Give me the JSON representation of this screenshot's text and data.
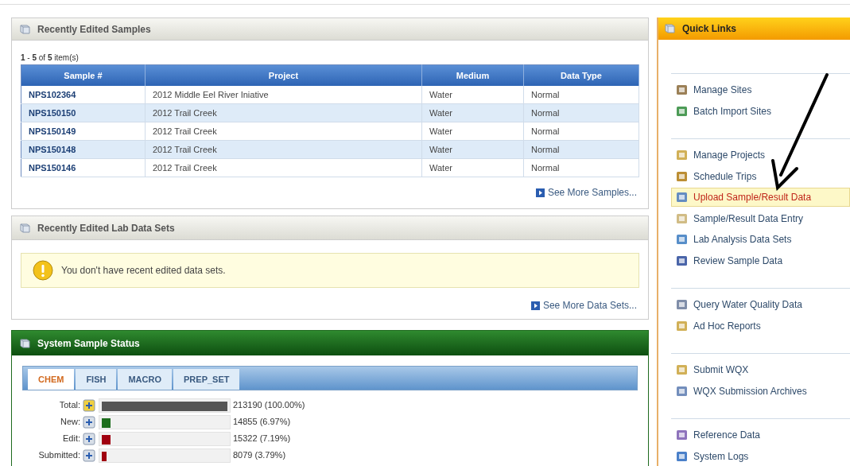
{
  "recent_samples": {
    "title": "Recently Edited Samples",
    "count_parts": [
      "1",
      "-",
      "5",
      "of",
      "5",
      "item(s)"
    ],
    "table": {
      "columns": [
        "Sample #",
        "Project",
        "Medium",
        "Data Type"
      ],
      "rows": [
        [
          "NPS102364",
          "2012 Middle Eel River Iniative",
          "Water",
          "Normal"
        ],
        [
          "NPS150150",
          "2012 Trail Creek",
          "Water",
          "Normal"
        ],
        [
          "NPS150149",
          "2012 Trail Creek",
          "Water",
          "Normal"
        ],
        [
          "NPS150148",
          "2012 Trail Creek",
          "Water",
          "Normal"
        ],
        [
          "NPS150146",
          "2012 Trail Creek",
          "Water",
          "Normal"
        ]
      ]
    },
    "more_link": "See More Samples..."
  },
  "lab_data_sets": {
    "title": "Recently Edited Lab Data Sets",
    "notice": "You don't have recent edited data sets.",
    "more_link": "See More Data Sets..."
  },
  "sample_status": {
    "title": "System Sample Status",
    "tabs": [
      {
        "label": "CHEM",
        "selected": true
      },
      {
        "label": "FISH",
        "selected": false
      },
      {
        "label": "MACRO",
        "selected": false
      },
      {
        "label": "PREP_SET",
        "selected": false
      }
    ],
    "stats": [
      {
        "label": "Total:",
        "level": 1,
        "color": "#555555",
        "reading": "213190 (100.00%)"
      },
      {
        "label": "New:",
        "level": 0.0697,
        "color": "#1e6e1e",
        "reading": "14855 (6.97%)"
      },
      {
        "label": "Edit:",
        "level": 0.0719,
        "color": "#a00010",
        "reading": "15322 (7.19%)"
      },
      {
        "label": "Submitted:",
        "level": 0.0379,
        "color": "#a00010",
        "reading": "8079 (3.79%)"
      }
    ]
  },
  "quick_links": {
    "title": "Quick Links",
    "groups": [
      [
        {
          "label": "Manage Sites",
          "highlighted": false
        },
        {
          "label": "Batch Import Sites",
          "highlighted": false
        }
      ],
      [
        {
          "label": "Manage Projects",
          "highlighted": false
        },
        {
          "label": "Schedule Trips",
          "highlighted": false
        },
        {
          "label": "Upload Sample/Result Data",
          "highlighted": true
        },
        {
          "label": "Sample/Result Data Entry",
          "highlighted": false
        },
        {
          "label": "Lab Analysis Data Sets",
          "highlighted": false
        },
        {
          "label": "Review Sample Data",
          "highlighted": false
        }
      ],
      [
        {
          "label": "Query Water Quality Data",
          "highlighted": false
        },
        {
          "label": "Ad Hoc Reports",
          "highlighted": false
        }
      ],
      [
        {
          "label": "Submit WQX",
          "highlighted": false
        },
        {
          "label": "WQX Submission Archives",
          "highlighted": false
        }
      ],
      [
        {
          "label": "Reference Data",
          "highlighted": false
        },
        {
          "label": "System Logs",
          "highlighted": false
        }
      ]
    ]
  }
}
